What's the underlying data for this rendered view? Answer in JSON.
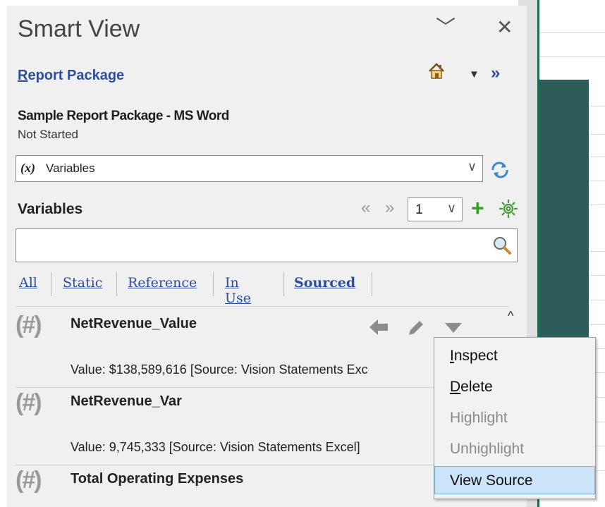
{
  "panel": {
    "title": "Smart View",
    "collapse_glyph": "﹀",
    "close_glyph": "✕",
    "package_link_first": "R",
    "package_link_rest": "eport Package",
    "doc_name": "Sample Report Package - MS Word",
    "doc_status": "Not Started",
    "expand_glyph": "»",
    "menu_glyph": "▼"
  },
  "variables_select": {
    "prefix": "(x)",
    "value": "Variables",
    "chevron": "∨"
  },
  "variables": {
    "header": "Variables",
    "page": "1",
    "prev_glyph": "«",
    "next_glyph": "»",
    "add_glyph": "+"
  },
  "search": {
    "placeholder": "",
    "value": ""
  },
  "filters": {
    "all": "All",
    "static": "Static",
    "reference": "Reference",
    "in_use": "In Use",
    "sourced": "Sourced"
  },
  "items": [
    {
      "name": "NetRevenue_Value",
      "value": "Value:  $138,589,616  [Source: Vision Statements Exc"
    },
    {
      "name": "NetRevenue_Var",
      "value": "Value:  9,745,333  [Source: Vision Statements Excel]"
    },
    {
      "name": "Total Operating Expenses",
      "value": ""
    }
  ],
  "item_icon_text": "(#)",
  "context_menu": {
    "inspect": {
      "access": "I",
      "rest": "nspect"
    },
    "delete": {
      "access": "D",
      "rest": "elete"
    },
    "highlight": "Highlight",
    "unhighlight": "Unhighlight",
    "view_source": "View Source"
  },
  "colors": {
    "link": "#2c4e9e",
    "menu_hover": "#cce4f7",
    "teal": "#2d5c5b",
    "add_green": "#3a9a2a"
  },
  "icons": [
    "home-icon",
    "refresh-icon",
    "gear-icon",
    "search-icon",
    "add-icon",
    "arrow-left-icon",
    "pencil-icon",
    "caret-down-icon"
  ]
}
